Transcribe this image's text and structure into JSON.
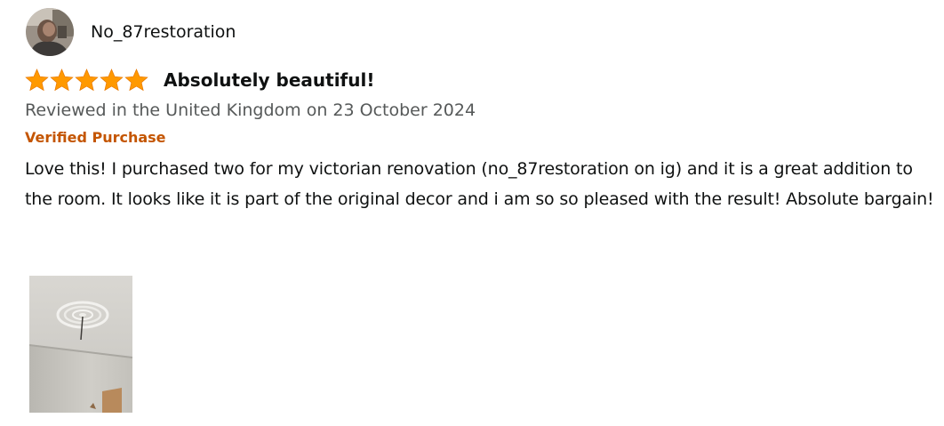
{
  "review": {
    "profile_name": "No_87restoration",
    "rating": 5,
    "rating_max": 5,
    "star_color": "#ff9900",
    "title": "Absolutely beautiful!",
    "date_text": "Reviewed in the United Kingdom on 23 October 2024",
    "verified_label": "Verified Purchase",
    "verified_color": "#c45500",
    "body": "Love this! I purchased two for my victorian renovation (no_87restoration on ig) and it is a great addition to the room. It looks like it is part of the original decor and i am so so pleased with the result! Absolute bargain!",
    "image_count": 1
  }
}
